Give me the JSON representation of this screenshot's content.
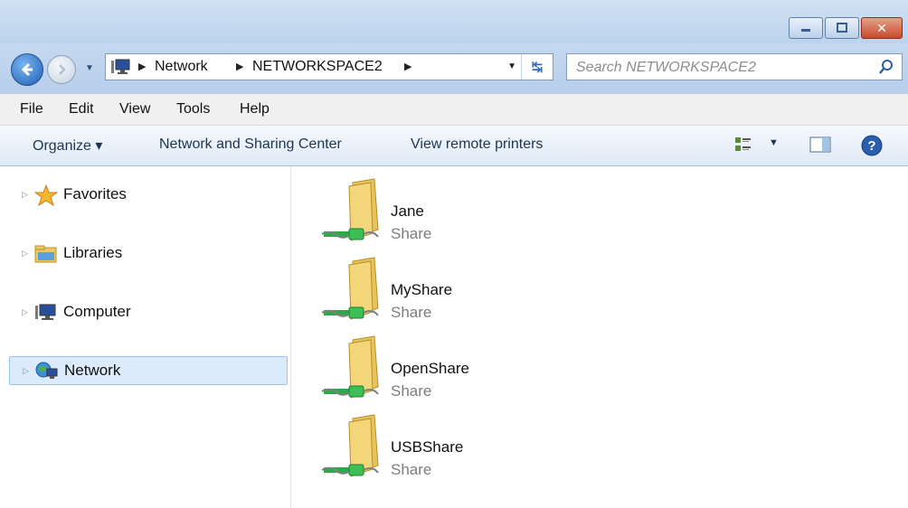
{
  "window": {
    "minimize_icon": "minimize-icon",
    "maximize_icon": "maximize-icon",
    "close_glyph": "✕"
  },
  "address": {
    "crumbs": [
      "Network",
      "NETWORKSPACE2"
    ],
    "search_placeholder": "Search NETWORKSPACE2"
  },
  "menu": [
    "File",
    "Edit",
    "View",
    "Tools",
    "Help"
  ],
  "toolbar": {
    "organize": "Organize ▾",
    "network_sharing": "Network and Sharing Center",
    "remote_printers": "View remote printers",
    "help_glyph": "?"
  },
  "nav": {
    "items": [
      {
        "label": "Favorites",
        "icon": "star-icon"
      },
      {
        "label": "Libraries",
        "icon": "library-icon"
      },
      {
        "label": "Computer",
        "icon": "computer-icon"
      },
      {
        "label": "Network",
        "icon": "network-icon",
        "selected": true
      }
    ]
  },
  "shares": [
    {
      "name": "Jane",
      "type": "Share"
    },
    {
      "name": "MyShare",
      "type": "Share"
    },
    {
      "name": "OpenShare",
      "type": "Share"
    },
    {
      "name": "USBShare",
      "type": "Share"
    }
  ],
  "colors": {
    "frame": "#bcd3ec",
    "selection": "#dcebfc",
    "close": "#c64a2c",
    "folder": "#f3d67a",
    "pipe": "#2fa84a"
  }
}
